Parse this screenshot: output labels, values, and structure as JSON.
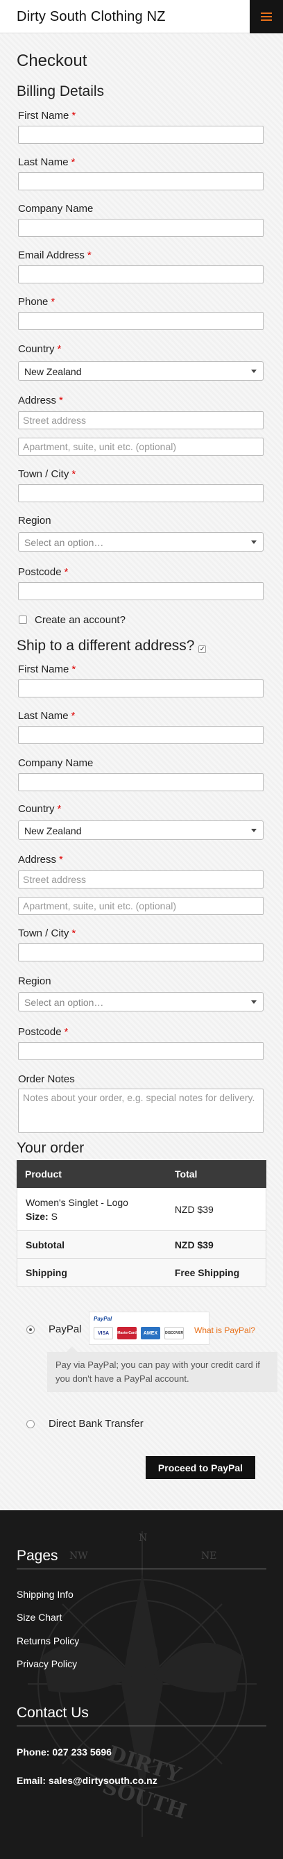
{
  "header": {
    "site_title": "Dirty South Clothing NZ"
  },
  "checkout": {
    "title": "Checkout",
    "billing_title": "Billing Details",
    "billing": {
      "first_name": "First Name",
      "last_name": "Last Name",
      "company": "Company Name",
      "email": "Email Address",
      "phone": "Phone",
      "country_label": "Country",
      "country_value": "New Zealand",
      "address_label": "Address",
      "street_placeholder": "Street address",
      "apartment_placeholder": "Apartment, suite, unit etc. (optional)",
      "town_label": "Town / City",
      "region_label": "Region",
      "region_placeholder": "Select an option…",
      "postcode_label": "Postcode",
      "create_account": "Create an account?"
    },
    "required_mark": "*",
    "ship_title": "Ship to a different address?",
    "shipping": {
      "first_name": "First Name",
      "last_name": "Last Name",
      "company": "Company Name",
      "country_label": "Country",
      "country_value": "New Zealand",
      "address_label": "Address",
      "street_placeholder": "Street address",
      "apartment_placeholder": "Apartment, suite, unit etc. (optional)",
      "town_label": "Town / City",
      "region_label": "Region",
      "region_placeholder": "Select an option…",
      "postcode_label": "Postcode",
      "order_notes_label": "Order Notes",
      "order_notes_placeholder": "Notes about your order, e.g. special notes for delivery."
    }
  },
  "order": {
    "title": "Your order",
    "col_product": "Product",
    "col_total": "Total",
    "item_name": "Women's Singlet - Logo",
    "size_label": "Size:",
    "size_value": "S",
    "item_total": "NZD $39",
    "subtotal_label": "Subtotal",
    "subtotal_value": "NZD $39",
    "shipping_label": "Shipping",
    "shipping_value": "Free Shipping"
  },
  "payment": {
    "paypal_label": "PayPal",
    "paypal_logo_text": "PayPal",
    "cards": [
      "VISA",
      "MasterCard",
      "AMEX",
      "DISCOVER"
    ],
    "what_is_paypal": "What is PayPal?",
    "paypal_desc": "Pay via PayPal; you can pay with your credit card if you don't have a PayPal account.",
    "bank_label": "Direct Bank Transfer",
    "proceed_label": "Proceed to PayPal",
    "accent_color": "#e8701a"
  },
  "footer": {
    "pages_title": "Pages",
    "links": [
      "Shipping Info",
      "Size Chart",
      "Returns Policy",
      "Privacy Policy"
    ],
    "contact_title": "Contact Us",
    "phone": "Phone: 027 233 5696",
    "email": "Email: sales@dirtysouth.co.nz",
    "emblem_text_1": "DIRTY",
    "emblem_text_2": "SOUTH",
    "compass_n": "N",
    "compass_ne": "NE",
    "compass_nw": "NW"
  }
}
